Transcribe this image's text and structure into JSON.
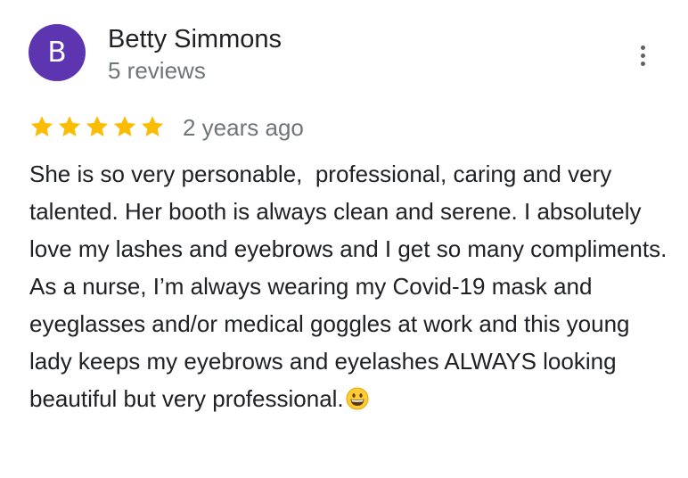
{
  "review": {
    "author": {
      "initial": "B",
      "name": "Betty Simmons",
      "review_count": "5 reviews",
      "avatar_color": "#5E35B1"
    },
    "rating": 5,
    "rating_max": 5,
    "star_color": "#FBBC04",
    "date": "2 years ago",
    "text": "She is so very personable,  professional, caring and very talented. Her booth is always clean and serene. I absolutely love my lashes and eyebrows and I get so many compliments. As a nurse, I’m always wearing my Covid-19 mask and eyeglasses and/or medical goggles at work and this young lady keeps my eyebrows and eyelashes ALWAYS looking beautiful but very professional.",
    "trailing_emoji": "grinning-face-emoji",
    "more_options_icon": "more-vert-icon"
  }
}
